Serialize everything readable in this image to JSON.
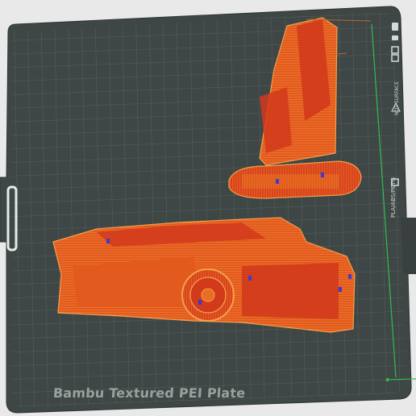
{
  "plate": {
    "name": "Bambu Textured PEI Plate",
    "hint_text": "NOT SURFACE",
    "filament_types": "PLA/ABS/PETG"
  },
  "colors": {
    "background": "#e9e9e9",
    "bed": "#3f4646",
    "grid": "#5c6464",
    "model_orange": "#e86f22",
    "model_red": "#d23a1c",
    "model_outline": "#f3a04a",
    "axis_green": "#2fbf4f"
  },
  "icons": [
    "grid-icon",
    "bed-icons",
    "model-part-icon"
  ]
}
